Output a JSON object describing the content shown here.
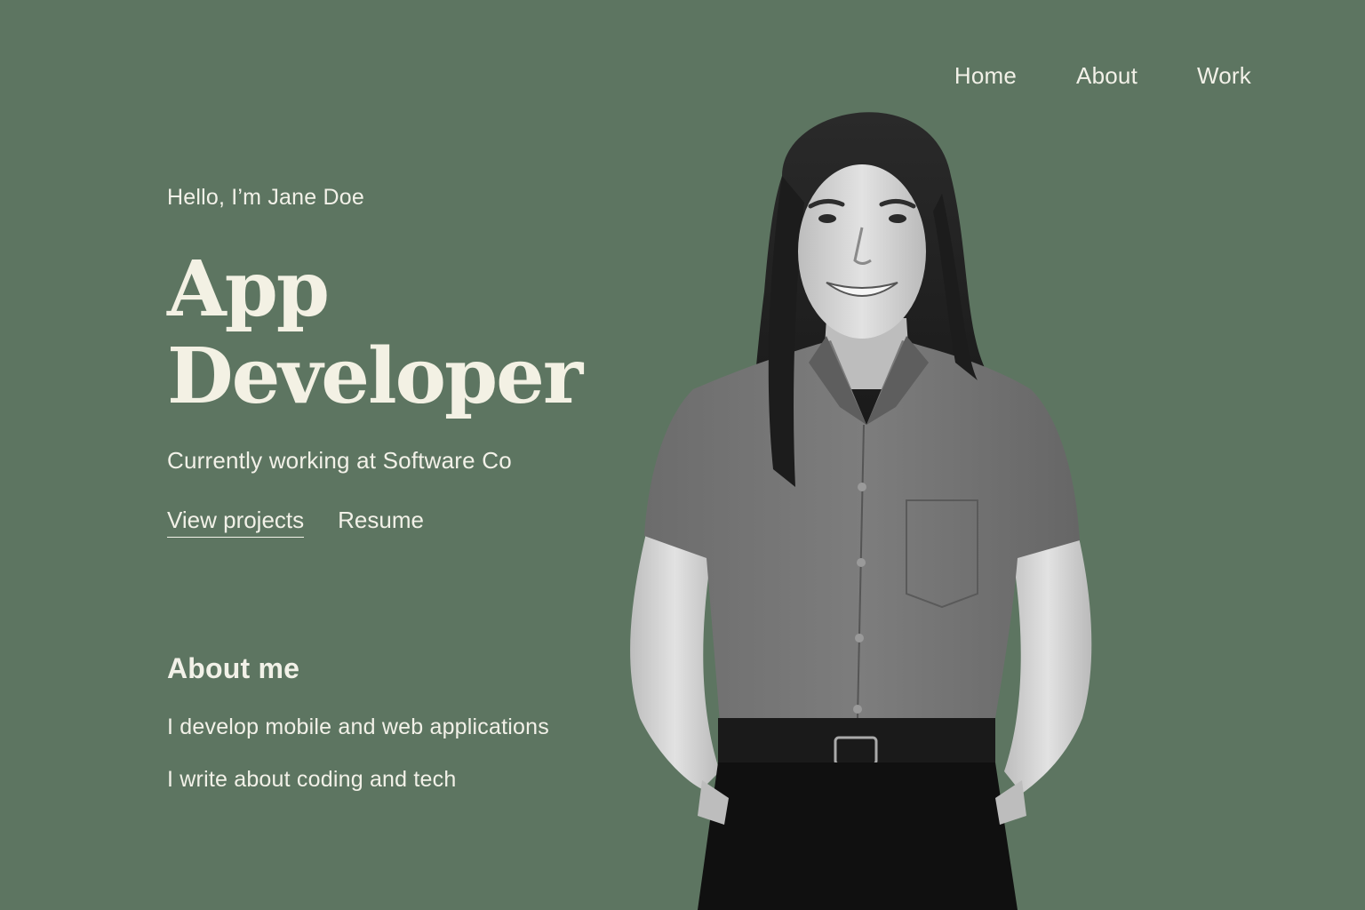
{
  "nav": {
    "items": [
      {
        "label": "Home"
      },
      {
        "label": "About"
      },
      {
        "label": "Work"
      }
    ]
  },
  "hero": {
    "greeting": "Hello, I’m Jane Doe",
    "title_line1": "App",
    "title_line2": "Developer",
    "subtitle": "Currently working at Software Co",
    "primary_link": "View projects",
    "secondary_link": "Resume"
  },
  "about": {
    "heading": "About me",
    "items": [
      "I develop mobile and web applications",
      "I write about coding and tech"
    ]
  },
  "colors": {
    "background": "#5d7561",
    "text": "#f2f1e8"
  }
}
